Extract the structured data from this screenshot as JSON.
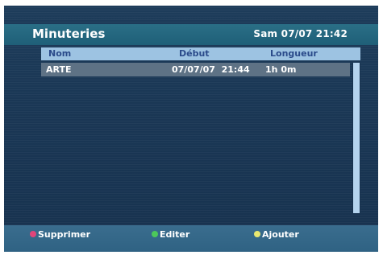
{
  "header": {
    "title": "Minuteries",
    "clock": "Sam 07/07 21:42"
  },
  "table": {
    "columns": [
      "Nom",
      "Début",
      "Longueur"
    ],
    "rows": [
      {
        "name": "ARTE",
        "start": "07/07/07  21:44",
        "length": "1h 0m"
      }
    ]
  },
  "footer": {
    "actions": [
      {
        "label": "Supprimer",
        "color": "#e0457a"
      },
      {
        "label": "Editer",
        "color": "#4cc85a"
      },
      {
        "label": "Ajouter",
        "color": "#e8e870"
      }
    ]
  }
}
